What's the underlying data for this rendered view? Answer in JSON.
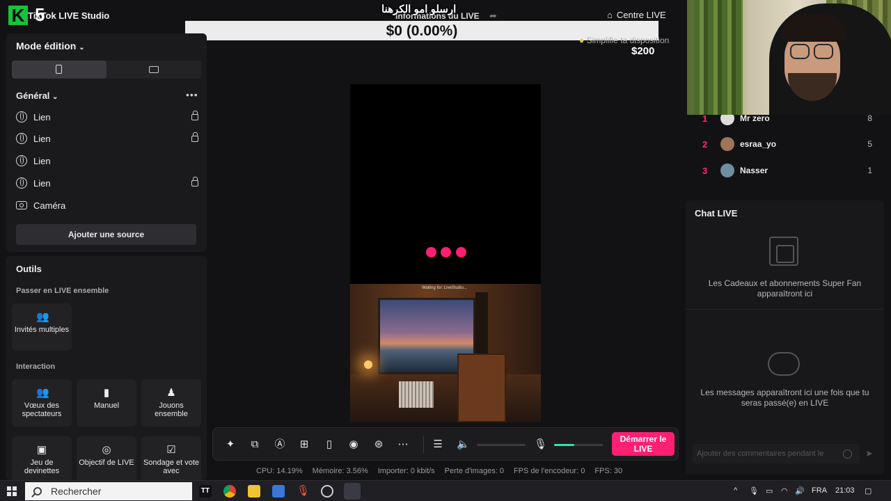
{
  "titlebar": {
    "logo_letter": "K",
    "logo_number": "5",
    "app_title": "TikTok LIVE Studio",
    "center_title": "Informations du LIVE",
    "overlay_arabic": "ارسلو امو الكرهنا",
    "centre_live": "Centre LIVE"
  },
  "overlay": {
    "money_bar": "$0 (0.00%)",
    "money_left": "$0",
    "simplify": "Simplifie ta disposition",
    "money_right": "$200"
  },
  "left_panel": {
    "mode_label": "Mode édition",
    "general_label": "Général",
    "sources": [
      {
        "label": "Lien",
        "icon": "globe-icon",
        "locked": true
      },
      {
        "label": "Lien",
        "icon": "globe-icon",
        "locked": true
      },
      {
        "label": "Lien",
        "icon": "globe-icon",
        "locked": false
      },
      {
        "label": "Lien",
        "icon": "globe-icon",
        "locked": true
      },
      {
        "label": "Caméra",
        "icon": "camera-icon",
        "locked": false
      }
    ],
    "add_source": "Ajouter une source"
  },
  "tools": {
    "title": "Outils",
    "section_live_together": "Passer en LIVE ensemble",
    "multi_guests": "Invités multiples",
    "section_interaction": "Interaction",
    "tiles": [
      {
        "label": "Vœux des spectateurs",
        "icon": "users-icon"
      },
      {
        "label": "Manuel",
        "icon": "book-icon"
      },
      {
        "label": "Jouons ensemble",
        "icon": "joystick-icon"
      },
      {
        "label": "Jeu de devinettes",
        "icon": "guess-icon"
      },
      {
        "label": "Objectif de LIVE",
        "icon": "target-icon"
      },
      {
        "label": "Sondage et vote avec",
        "icon": "poll-icon"
      }
    ]
  },
  "preview": {
    "caption": "Waiting for: LiveStudio..."
  },
  "toolbar": {
    "go_live": "Démarrer le LIVE",
    "mic_level": 0.42,
    "volume_level": 0.0
  },
  "stats": {
    "cpu": "CPU: 14.19%",
    "memory": "Mémoire: 3.56%",
    "import": "Importer: 0 kbit/s",
    "frame_loss": "Perte d'images: 0",
    "encoder_fps": "FPS de l'encodeur: 0",
    "fps": "FPS: 30"
  },
  "ranking": [
    {
      "rank": "1",
      "name": "Mr zero",
      "count": "8"
    },
    {
      "rank": "2",
      "name": "esraa_yo",
      "count": "5"
    },
    {
      "rank": "3",
      "name": "Nasser",
      "count": "1"
    }
  ],
  "chat": {
    "title": "Chat LIVE",
    "gifts_text": "Les Cadeaux et abonnements Super Fan apparaîtront ici",
    "messages_text": "Les messages apparaîtront ici une fois que tu seras passé(e) en LIVE",
    "comment_placeholder": "Ajouter des commentaires pendant le"
  },
  "taskbar": {
    "search": "Rechercher",
    "language": "FRA",
    "time": "21:03"
  },
  "colors": {
    "accent_pink": "#ff1f73",
    "mic_green": "#2ee6a8",
    "rank_red": "#ff2a6e"
  }
}
